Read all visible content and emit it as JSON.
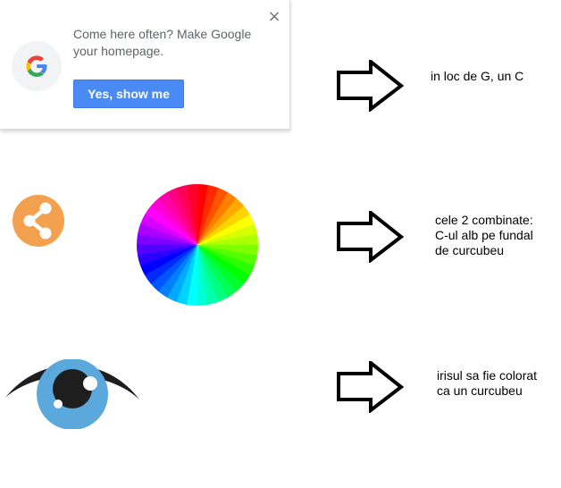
{
  "promo": {
    "close_label": "×",
    "message": "Come here often? Make Google your homepage.",
    "button_label": "Yes, show me",
    "logo_letter": "G"
  },
  "notes": [
    {
      "text": "in loc de G, un C"
    },
    {
      "text": "cele 2 combinate:\nC-ul alb pe fundal\nde curcubeu"
    },
    {
      "text": "irisul sa fie colorat\nca un curcubeu"
    }
  ],
  "icons": {
    "share": "share-icon",
    "color_wheel": "color-wheel-icon",
    "eye": "eye-icon",
    "arrow": "right-arrow-icon"
  },
  "colors": {
    "button_blue": "#4a8af4",
    "share_orange": "#f4a14f",
    "iris_blue": "#5ba9dc",
    "google_red": "#ea4335",
    "google_yellow": "#fbbc05",
    "google_green": "#34a853",
    "google_blue": "#4285f4"
  }
}
